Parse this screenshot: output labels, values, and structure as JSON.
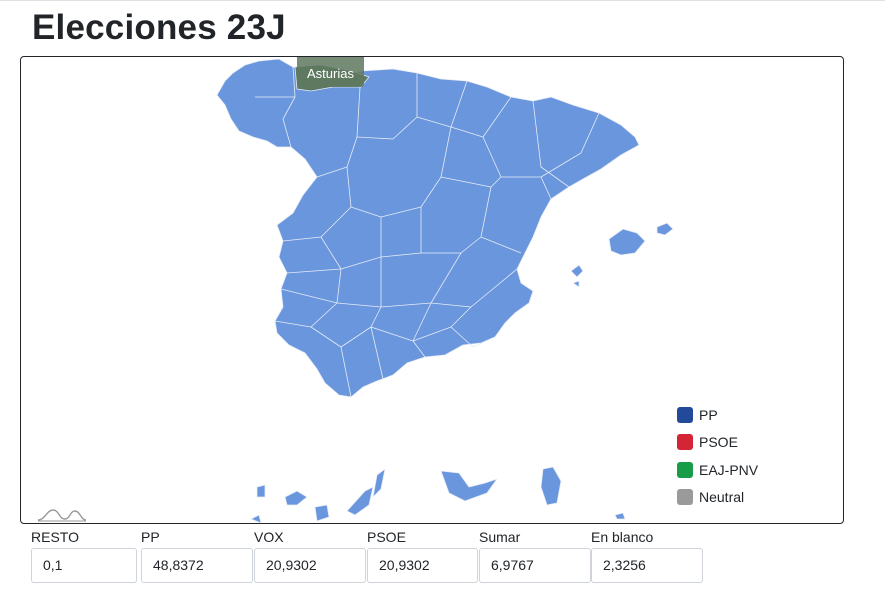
{
  "page": {
    "title": "Elecciones 23J"
  },
  "map": {
    "tooltip": "Asturias",
    "region_color": "#6a96dd",
    "border_color": "#e6ecf6"
  },
  "legend": [
    {
      "label": "PP",
      "color": "#234a9a"
    },
    {
      "label": "PSOE",
      "color": "#d32535"
    },
    {
      "label": "EAJ-PNV",
      "color": "#199c47"
    },
    {
      "label": "Neutral",
      "color": "#9a9a9a"
    }
  ],
  "results": [
    {
      "label": "RESTO",
      "value": "0,1"
    },
    {
      "label": "PP",
      "value": "48,8372"
    },
    {
      "label": "VOX",
      "value": "20,9302"
    },
    {
      "label": "PSOE",
      "value": "20,9302"
    },
    {
      "label": "Sumar",
      "value": "6,9767"
    },
    {
      "label": "En blanco",
      "value": "2,3256"
    }
  ]
}
